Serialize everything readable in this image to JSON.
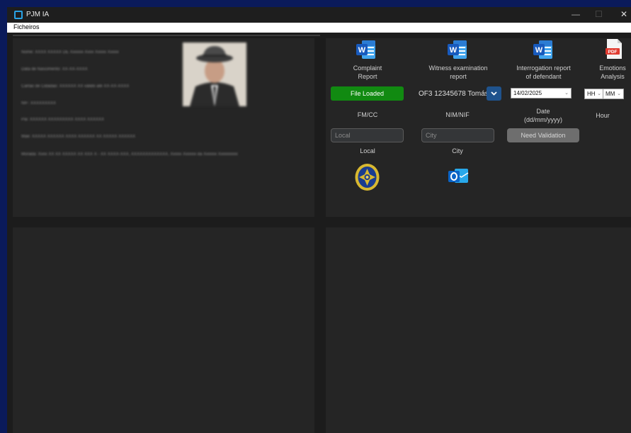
{
  "window": {
    "title": "PJM IA"
  },
  "menu": {
    "items": [
      "Ficheiros"
    ]
  },
  "person": {
    "info_lines": [
      "Nome: XXXX XXXXX DE Xxxxxx Xxxx Xxxxx Xxxxx",
      "Data de Nascimento: XX-XX-XXXX",
      "Cartão de Cidadão: XXXXXX XX válido até XX-XX-XXXX",
      "NIF: XXXXXXXXX",
      "Pai: XXXXXX XXXXXXXXX XXXX XXXXXX",
      "Mãe: XXXXX XXXXXX XXXX XXXXXX XX XXXXX XXXXXX",
      "Morada: Xxxx XX XX XXXXX XX XXX X - XX XXXX-XXX, XXXXXXXXXXXXX, Xxxxx Xxxxxx da Xxxxxx Xxxxxxxxx"
    ]
  },
  "reports": [
    {
      "label_line1": "Complaint",
      "label_line2": "Report",
      "icon": "word-icon"
    },
    {
      "label_line1": "Witness examination",
      "label_line2": "report",
      "icon": "word-icon"
    },
    {
      "label_line1": "Interrogation report",
      "label_line2": "of defendant",
      "icon": "word-icon"
    },
    {
      "label_line1": "Emotions",
      "label_line2": "Analysis",
      "icon": "pdf-icon"
    }
  ],
  "status": {
    "file_loaded": "File Loaded"
  },
  "nim": {
    "value": "OF3 12345678 Tomás"
  },
  "date": {
    "value": "14/02/2025"
  },
  "hour": {
    "hh": "HH",
    "mm": "MM"
  },
  "labels": {
    "fmcc": "FM/CC",
    "nimnif": "NIM/NIF",
    "date_line1": "Date",
    "date_line2": "(dd/mm/yyyy)",
    "hour": "Hour",
    "local": "Local",
    "city": "City"
  },
  "inputs": {
    "local_placeholder": "Local",
    "city_placeholder": "City"
  },
  "buttons": {
    "need_validation": "Need Validation"
  },
  "colors": {
    "accent_green": "#118a11",
    "accent_blue": "#1f538d",
    "word_blue": "#185abd",
    "outlook_blue": "#0a64c6",
    "badge_gold": "#d8b830",
    "background": "#0a1a5a"
  }
}
